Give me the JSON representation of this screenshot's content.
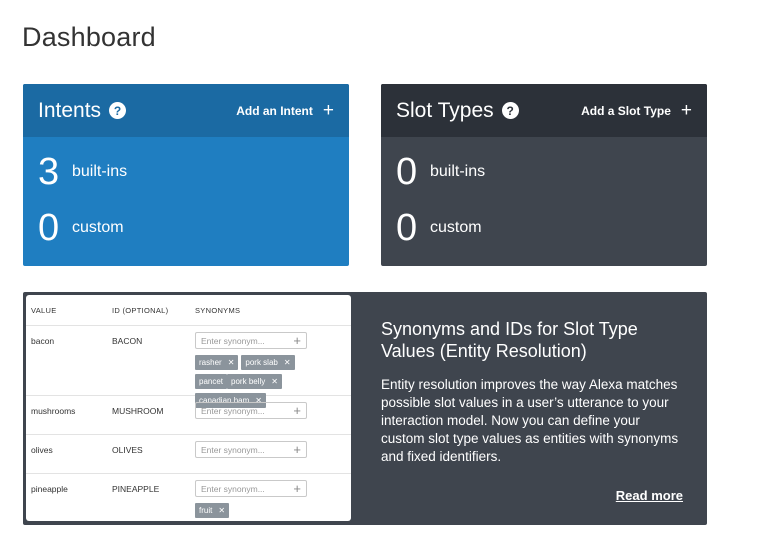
{
  "page": {
    "title": "Dashboard"
  },
  "intents_card": {
    "title": "Intents",
    "action_label": "Add an Intent",
    "builtins_count": "3",
    "builtins_label": "built-ins",
    "custom_count": "0",
    "custom_label": "custom"
  },
  "slot_types_card": {
    "title": "Slot Types",
    "action_label": "Add a Slot Type",
    "builtins_count": "0",
    "builtins_label": "built-ins",
    "custom_count": "0",
    "custom_label": "custom"
  },
  "info_panel": {
    "title": "Synonyms and IDs for Slot Type Values (Entity Resolution)",
    "body": "Entity resolution improves the way Alexa matches possible slot values in a user’s utterance to your interaction model. Now you can define your custom slot type values as entities with synonyms and fixed identifiers.",
    "read_more": "Read more",
    "table": {
      "headers": {
        "value": "VALUE",
        "id": "ID (OPTIONAL)",
        "synonyms": "SYNONYMS"
      },
      "placeholder": "Enter synonym...",
      "rows": [
        {
          "value": "bacon",
          "id": "BACON",
          "chips": [
            "rasher",
            "pork slab",
            "pancet",
            "pork belly",
            "canadian ham"
          ]
        },
        {
          "value": "mushrooms",
          "id": "MUSHROOM"
        },
        {
          "value": "olives",
          "id": "OLIVES"
        },
        {
          "value": "pineapple",
          "id": "PINEAPPLE",
          "chips": [
            "fruit"
          ]
        }
      ]
    }
  },
  "colors": {
    "intents_bg": "#1f7ec1",
    "intents_header": "#1b6aa3",
    "slots_bg": "#3f454e",
    "slots_header": "#2c3139",
    "chip_bg": "#8b949c"
  },
  "icons": {
    "help": "help-circle-icon",
    "add": "plus-icon",
    "remove_chip": "close-icon"
  }
}
